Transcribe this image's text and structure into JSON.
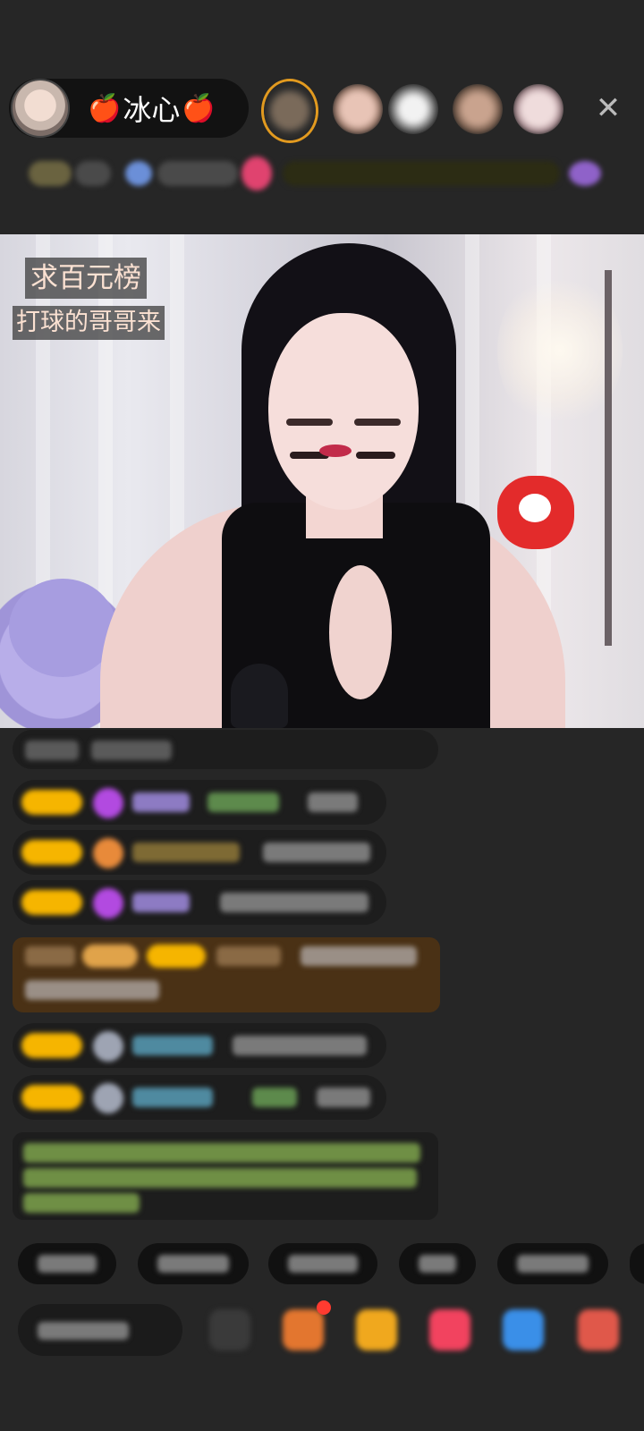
{
  "host": {
    "name": "冰心",
    "apple_left": "🍎",
    "apple_right": "🍎"
  },
  "header": {
    "close_glyph": "✕"
  },
  "overlay": {
    "caption_1": "求百元榜",
    "caption_2": "打球的哥哥来"
  },
  "colors": {
    "badge": "#f6b500",
    "background": "#262626",
    "special_message": "#4a3115"
  }
}
